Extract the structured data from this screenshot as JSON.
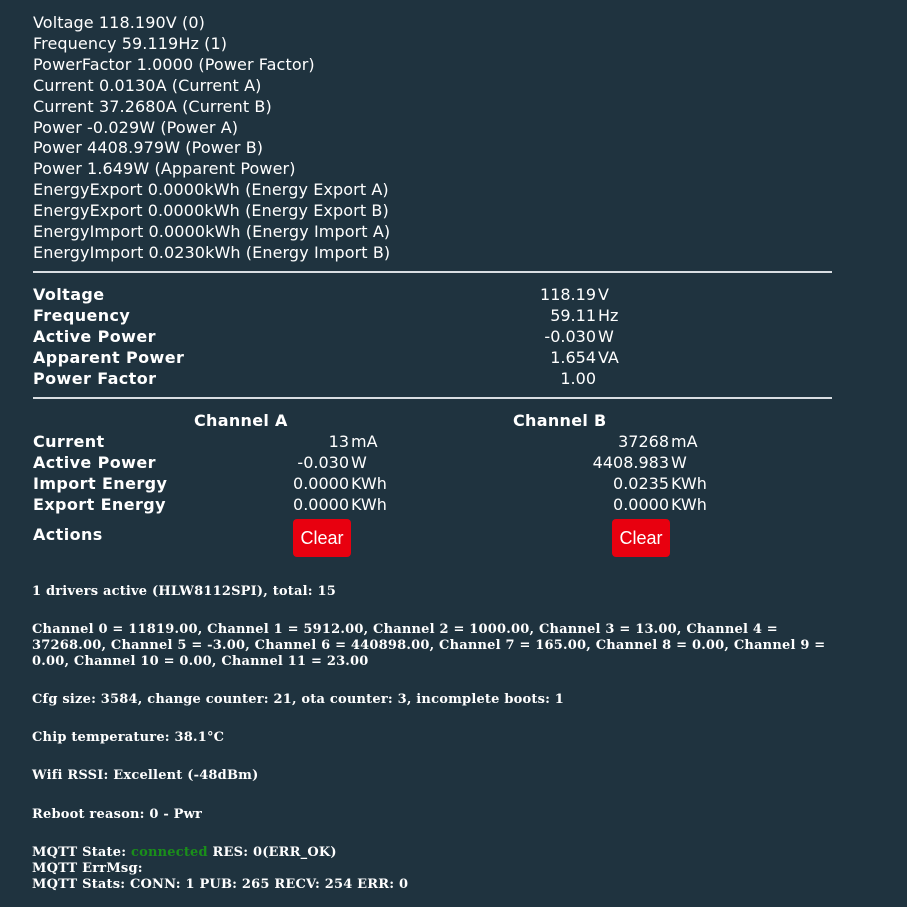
{
  "raw_readings": [
    "Voltage 118.190V (0)",
    "Frequency 59.119Hz (1)",
    "PowerFactor 1.0000 (Power Factor)",
    "Current 0.0130A (Current A)",
    "Current 37.2680A (Current B)",
    "Power -0.029W (Power A)",
    "Power 4408.979W (Power B)",
    "Power 1.649W (Apparent Power)",
    "EnergyExport 0.0000kWh (Energy Export A)",
    "EnergyExport 0.0000kWh (Energy Export B)",
    "EnergyImport 0.0000kWh (Energy Import A)",
    "EnergyImport 0.0230kWh (Energy Import B)"
  ],
  "summary": [
    {
      "label": "Voltage",
      "value": "118.19",
      "unit": "V"
    },
    {
      "label": "Frequency",
      "value": "59.11",
      "unit": "Hz"
    },
    {
      "label": "Active Power",
      "value": "-0.030",
      "unit": "W"
    },
    {
      "label": "Apparent Power",
      "value": "1.654",
      "unit": "VA"
    },
    {
      "label": "Power Factor",
      "value": "1.00",
      "unit": ""
    }
  ],
  "channels": {
    "header_a": "Channel A",
    "header_b": "Channel B",
    "rows": [
      {
        "label": "Current",
        "a_value": "13",
        "a_unit": "mA",
        "b_value": "37268",
        "b_unit": "mA"
      },
      {
        "label": "Active Power",
        "a_value": "-0.030",
        "a_unit": "W",
        "b_value": "4408.983",
        "b_unit": "W"
      },
      {
        "label": "Import Energy",
        "a_value": "0.0000",
        "a_unit": "KWh",
        "b_value": "0.0235",
        "b_unit": "KWh"
      },
      {
        "label": "Export Energy",
        "a_value": "0.0000",
        "a_unit": "KWh",
        "b_value": "0.0000",
        "b_unit": "KWh"
      }
    ],
    "actions_label": "Actions",
    "clear_a_label": "Clear",
    "clear_b_label": "Clear"
  },
  "info": {
    "drivers": "1 drivers active (HLW8112SPI), total: 15",
    "channels": "Channel 0 = 11819.00, Channel 1 = 5912.00, Channel 2 = 1000.00, Channel 3 = 13.00, Channel 4 = 37268.00, Channel 5 = -3.00, Channel 6 = 440898.00, Channel 7 = 165.00, Channel 8 = 0.00, Channel 9 = 0.00, Channel 10 = 0.00, Channel 11 = 23.00",
    "cfg": "Cfg size: 3584, change counter: 21, ota counter: 3, incomplete boots: 1",
    "chip_temp": "Chip temperature: 38.1°C",
    "wifi": "Wifi RSSI: Excellent (-48dBm)",
    "reboot": "Reboot reason: 0 - Pwr",
    "mqtt_state_prefix": "MQTT State: ",
    "mqtt_state_value": "connected",
    "mqtt_state_suffix": " RES: 0(ERR_OK)",
    "mqtt_errmsg": "MQTT ErrMsg:",
    "mqtt_stats": "MQTT Stats: CONN: 1 PUB: 265 RECV: 254 ERR: 0"
  },
  "colors": {
    "background": "#1f333f",
    "button": "#e8000f",
    "connected": "#1a8f1a"
  }
}
